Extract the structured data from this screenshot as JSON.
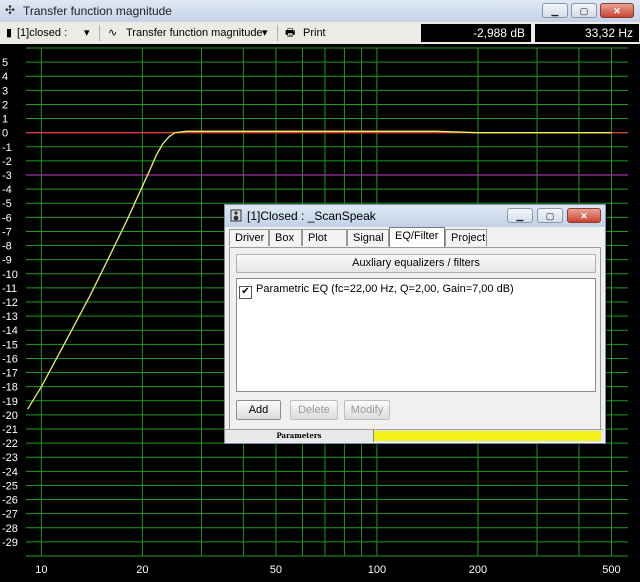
{
  "window": {
    "title": "Transfer function magnitude"
  },
  "toolbar": {
    "case_select": "[1]closed :",
    "plot_select": "Transfer function magnitude",
    "print_label": "Print",
    "readout_db": "-2,988 dB",
    "readout_hz": "33,32 Hz"
  },
  "plot": {
    "colors": {
      "background": "#000000",
      "grid": "#1f9a1f",
      "minor_grid": "#0d5a0d",
      "curve": "#f0f060",
      "ref_line": "#d04040",
      "ref_line2": "#a030a0"
    },
    "y_ticks": [
      "5",
      "4",
      "3",
      "2",
      "1",
      "0",
      "-1",
      "-2",
      "-3",
      "-4",
      "-5",
      "-6",
      "-7",
      "-8",
      "-9",
      "-10",
      "-11",
      "-12",
      "-13",
      "-14",
      "-15",
      "-16",
      "-17",
      "-18",
      "-19",
      "-20",
      "-21",
      "-22",
      "-23",
      "-24",
      "-25",
      "-26",
      "-27",
      "-28",
      "-29"
    ],
    "x_ticks": [
      "10",
      "20",
      "50",
      "100",
      "200",
      "500"
    ]
  },
  "chart_data": {
    "type": "line",
    "title": "Transfer function magnitude",
    "xlabel": "",
    "ylabel": "",
    "xscale": "log",
    "xlim": [
      9,
      560
    ],
    "ylim": [
      -30,
      6
    ],
    "grid": true,
    "series": [
      {
        "color": "#f0f060",
        "x": [
          9.1,
          10,
          12,
          14,
          16,
          18,
          20,
          21,
          22,
          23,
          24,
          25,
          27,
          30,
          35,
          40,
          50,
          70,
          100,
          150,
          200,
          300,
          500
        ],
        "y": [
          -19.6,
          -18,
          -14.5,
          -11.5,
          -8.7,
          -6.2,
          -3.8,
          -2.7,
          -1.6,
          -0.8,
          -0.3,
          0.0,
          0.1,
          0.1,
          0.1,
          0.1,
          0.1,
          0.1,
          0.1,
          0.1,
          0.0,
          0.0,
          0.0
        ]
      }
    ],
    "reference_lines": [
      {
        "y": 0,
        "color": "#d04040"
      },
      {
        "y": -3,
        "color": "#a030a0"
      }
    ]
  },
  "dialog": {
    "title": "[1]Closed : _ScanSpeak",
    "tabs": [
      "Driver",
      "Box",
      "Plot",
      "Signal",
      "EQ/Filter",
      "Project"
    ],
    "selected_tab": "EQ/Filter",
    "header_button": "Auxliary equalizers / filters",
    "items": [
      {
        "checked": true,
        "label": "Parametric EQ (fc=22,00 Hz, Q=2,00, Gain=7,00 dB)"
      }
    ],
    "buttons": {
      "add": "Add",
      "delete": "Delete",
      "modify": "Modify"
    },
    "status_label": "Parameters"
  }
}
